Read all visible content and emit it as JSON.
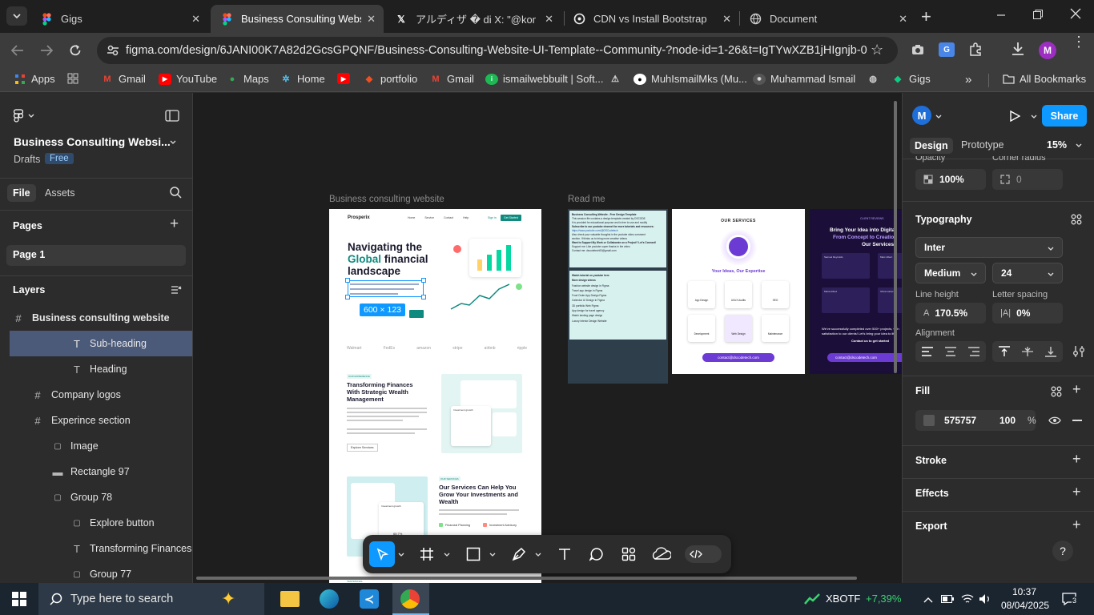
{
  "browser": {
    "tabs": [
      {
        "title": "Gigs",
        "icon": "figma-icon"
      },
      {
        "title": "Business Consulting Website",
        "icon": "figma-icon",
        "active": true
      },
      {
        "title": "アルディザ � di X: \"@kom",
        "icon": "x-icon"
      },
      {
        "title": "CDN vs Install Bootstrap",
        "icon": "chatgpt-icon"
      },
      {
        "title": "Document",
        "icon": "globe-icon"
      }
    ],
    "url": "figma.com/design/6JANI00K7A82d2GcsGPQNF/Business-Consulting-Website-UI-Template--Community-?node-id=1-26&t=IgTYwXZB1jHIgnjb-0",
    "bookmarks": [
      {
        "label": "Apps"
      },
      {
        "label": "Gmail"
      },
      {
        "label": "YouTube"
      },
      {
        "label": "Maps"
      },
      {
        "label": "Home"
      },
      {
        "label": "portfolio"
      },
      {
        "label": "Gmail"
      },
      {
        "label": "ismailwebbuilt | Soft..."
      },
      {
        "label": "MuhIsmailMks (Mu..."
      },
      {
        "label": "Muhammad Ismail"
      },
      {
        "label": "Gigs"
      }
    ],
    "all_bookmarks": "All Bookmarks",
    "profile_initial": "M"
  },
  "figma": {
    "file_title": "Business Consulting Websi...",
    "drafts": "Drafts",
    "plan_badge": "Free",
    "tabs": {
      "file": "File",
      "assets": "Assets"
    },
    "pages_label": "Pages",
    "page": "Page 1",
    "layers_label": "Layers",
    "layers": [
      {
        "name": "Business consulting website",
        "icon": "frame-icon"
      },
      {
        "name": "Sub-heading",
        "icon": "text-icon",
        "selected": true
      },
      {
        "name": "Heading",
        "icon": "text-icon"
      },
      {
        "name": "Company logos",
        "icon": "frame-icon"
      },
      {
        "name": "Experince section",
        "icon": "frame-icon"
      },
      {
        "name": "Image",
        "icon": "group-icon"
      },
      {
        "name": "Rectangle 97",
        "icon": "rectangle-icon"
      },
      {
        "name": "Group 78",
        "icon": "group-icon"
      },
      {
        "name": "Explore button",
        "icon": "group-icon"
      },
      {
        "name": "Transforming Finances W",
        "icon": "text-icon"
      },
      {
        "name": "Group 77",
        "icon": "group-icon"
      }
    ],
    "canvas": {
      "frame1_label": "Business consulting website",
      "frame2_label": "Read me",
      "selection_size": "600 × 123",
      "site": {
        "brand": "Prosperix",
        "nav": [
          "Home",
          "Service",
          "Contact",
          "Help"
        ],
        "signin": "Sign in",
        "cta": "Get Started",
        "hero_line1": "Navigating the",
        "hero_global": "Global",
        "hero_line2": " financial",
        "hero_line3": "landscape",
        "logos": [
          "Walmart",
          "FedEx",
          "amazon",
          "stripe",
          "airbnb",
          "ripple"
        ],
        "section2_tag": "OUR EXPERIENCE",
        "section2_title": "Transforming Finances With Strategic Wealth Management",
        "explore": "Explore Services",
        "investment_growth": "Investment growth",
        "section3_tag": "OUR SERVICES",
        "section3_title": "Our Services Can Help You Grow Your Investments and Wealth",
        "financial_planning": "Financial Planning",
        "investment_advisory": "Investment Advisory",
        "percent": "68.7%",
        "testimonial": "TESTIMONIAL"
      },
      "readme": {
        "title": "Business Consulting Website - Free Design Template",
        "lines": [
          "This session file contains a design template created by DSCODE",
          "It is provided for educational purpose and is free to use and modify",
          "Subscribe to our youtube channel for more tutorials and resources:",
          "https://www.youtube.com/@DSCodetech",
          "Also check your valuable thoughts in the youtube video comment",
          "section. If thinks us to bring more creative videos",
          "Want to Support My Work or Collaborate on a Project? Let's Connect!",
          "Support me: Like youtube super thanks in the video",
          "Contact me: dscodetech00@gmail.com"
        ],
        "watch": "Watch tutorial on youtube here",
        "more_videos": "More design videos",
        "videos": [
          "Fashion website design in Figma",
          "Travel app design in Figma",
          "Food Order App Design Figma",
          "Calendar UI Design in Figma",
          "3D portfolio Web Figma",
          "App design for travel agency",
          "Watch landing page design",
          "Luxury Interior Design Website"
        ]
      },
      "services": {
        "title": "OUR SERVICES",
        "tagline": "Your Ideas, Our Expertise",
        "items": [
          "App Design",
          "UI/UX Audits",
          "SEO",
          "Development",
          "Web Design",
          "Maintenance"
        ],
        "email": "contact@dscodetech.com"
      },
      "reviews": {
        "tag": "CLIENT REVIEWS",
        "title1": "Bring Your Idea into Digital",
        "title2": "From Concept to Creation",
        "title3": "Our Services",
        "names": [
          "Samuel Reynolds",
          "Marc Albert",
          "Maria Alfred",
          "Olivia Carter"
        ],
        "footer": "We've successfully completed over 500+ projects, with satisfaction to our clients! Let's bring your idea to life!",
        "contact": "Contact us to get started",
        "email": "contact@dscodetech.com"
      }
    },
    "toolbar": [
      "move-tool-icon",
      "frame-tool-icon",
      "shape-tool-icon",
      "pen-tool-icon",
      "text-tool-icon",
      "comment-tool-icon",
      "actions-icon",
      "ui3-icon",
      "dev-mode-icon"
    ],
    "right": {
      "avatar": "M",
      "share": "Share",
      "tab_design": "Design",
      "tab_prototype": "Prototype",
      "zoom": "15%",
      "opacity_label": "Opacity",
      "opacity": "100%",
      "corner_label": "Corner radius",
      "corner": "0",
      "typography": "Typography",
      "font": "Inter",
      "weight": "Medium",
      "size": "24",
      "line_height_label": "Line height",
      "line_height": "170.5%",
      "letter_spacing_label": "Letter spacing",
      "letter_spacing": "0%",
      "alignment_label": "Alignment",
      "fill": "Fill",
      "fill_hex": "575757",
      "fill_opacity": "100",
      "fill_pct": "%",
      "stroke": "Stroke",
      "effects": "Effects",
      "export": "Export",
      "help": "?"
    }
  },
  "taskbar": {
    "search_placeholder": "Type here to search",
    "ticker": "XBOTF",
    "ticker_change": "+7,39%",
    "time": "10:37",
    "date": "08/04/2025",
    "notif_count": "3"
  },
  "colors": {
    "accent": "#0d99ff",
    "teal": "#0f8a7e",
    "purple": "#6c3bd4",
    "taskbar": "#1b2530"
  }
}
